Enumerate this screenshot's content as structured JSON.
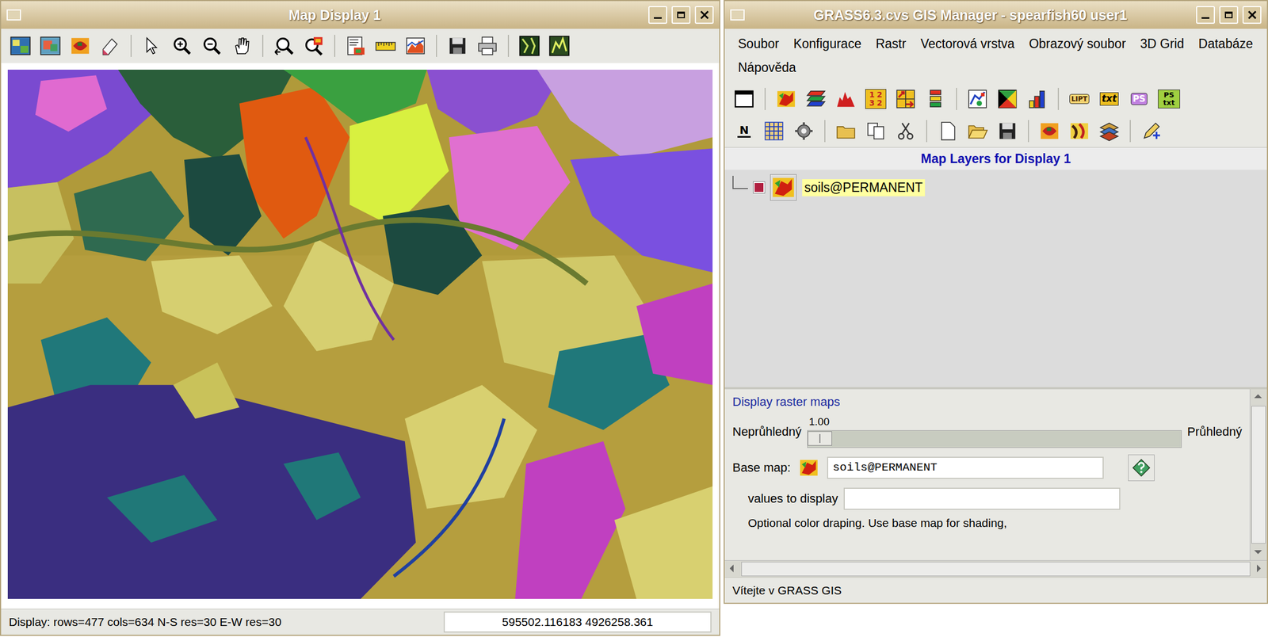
{
  "map_display": {
    "title": "Map Display 1",
    "status": "Display: rows=477 cols=634 N-S res=30 E-W res=30",
    "coordinates": "595502.116183 4926258.361"
  },
  "gis_manager": {
    "title": "GRASS6.3.cvs GIS Manager - spearfish60 user1",
    "menu": [
      "Soubor",
      "Konfigurace",
      "Rastr",
      "Vectorová vrstva",
      "Obrazový soubor",
      "3D Grid",
      "Databáze",
      "Nápověda"
    ],
    "icon_labels": {
      "numbers": "1232",
      "lipt": "LIPT",
      "txt": "txt",
      "ps": "PS",
      "ps_txt": "PS txt",
      "north": "N"
    },
    "layers_header": "Map Layers for Display 1",
    "layers": [
      {
        "name": "soils@PERMANENT",
        "checked": true,
        "selected": true
      }
    ],
    "options": {
      "title": "Display raster maps",
      "opacity": {
        "left": "Neprůhledný",
        "right": "Průhledný",
        "value": "1.00",
        "level": 0
      },
      "base_map": {
        "label": "Base map:",
        "value": "soils@PERMANENT"
      },
      "values": {
        "label": "values to display",
        "value": ""
      },
      "note": "Optional color draping. Use base map for shading,"
    },
    "status": "Vítejte v GRASS GIS"
  }
}
